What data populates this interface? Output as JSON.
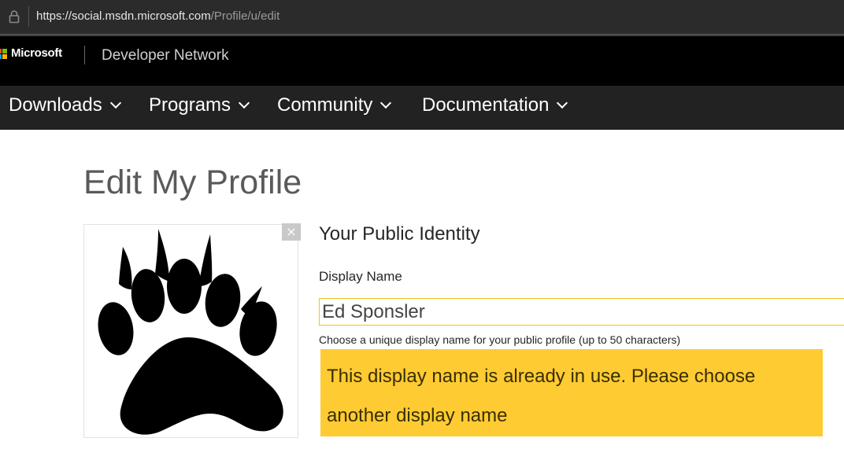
{
  "browser": {
    "url_host": "https://social.msdn.microsoft.com",
    "url_path": "/Profile/u/edit"
  },
  "brand": {
    "company": "Microsoft",
    "site": "Developer Network",
    "logo_colors": [
      "#f25022",
      "#7fba00",
      "#00a4ef",
      "#ffb900"
    ]
  },
  "nav": {
    "items": [
      {
        "label": "Downloads"
      },
      {
        "label": "Programs"
      },
      {
        "label": "Community"
      },
      {
        "label": "Documentation"
      }
    ]
  },
  "page": {
    "title": "Edit My Profile"
  },
  "avatar": {
    "icon": "bear-paw-icon",
    "remove_label": "×"
  },
  "identity": {
    "section_title": "Your Public Identity",
    "display_name_label": "Display Name",
    "display_name_value": "Ed Sponsler",
    "hint": "Choose a unique display name for your public profile (up to 50 characters)",
    "error": "This display name is already in use. Please choose another display name",
    "error_color": "#ffcb33",
    "input_border_color": "#f0c419"
  }
}
